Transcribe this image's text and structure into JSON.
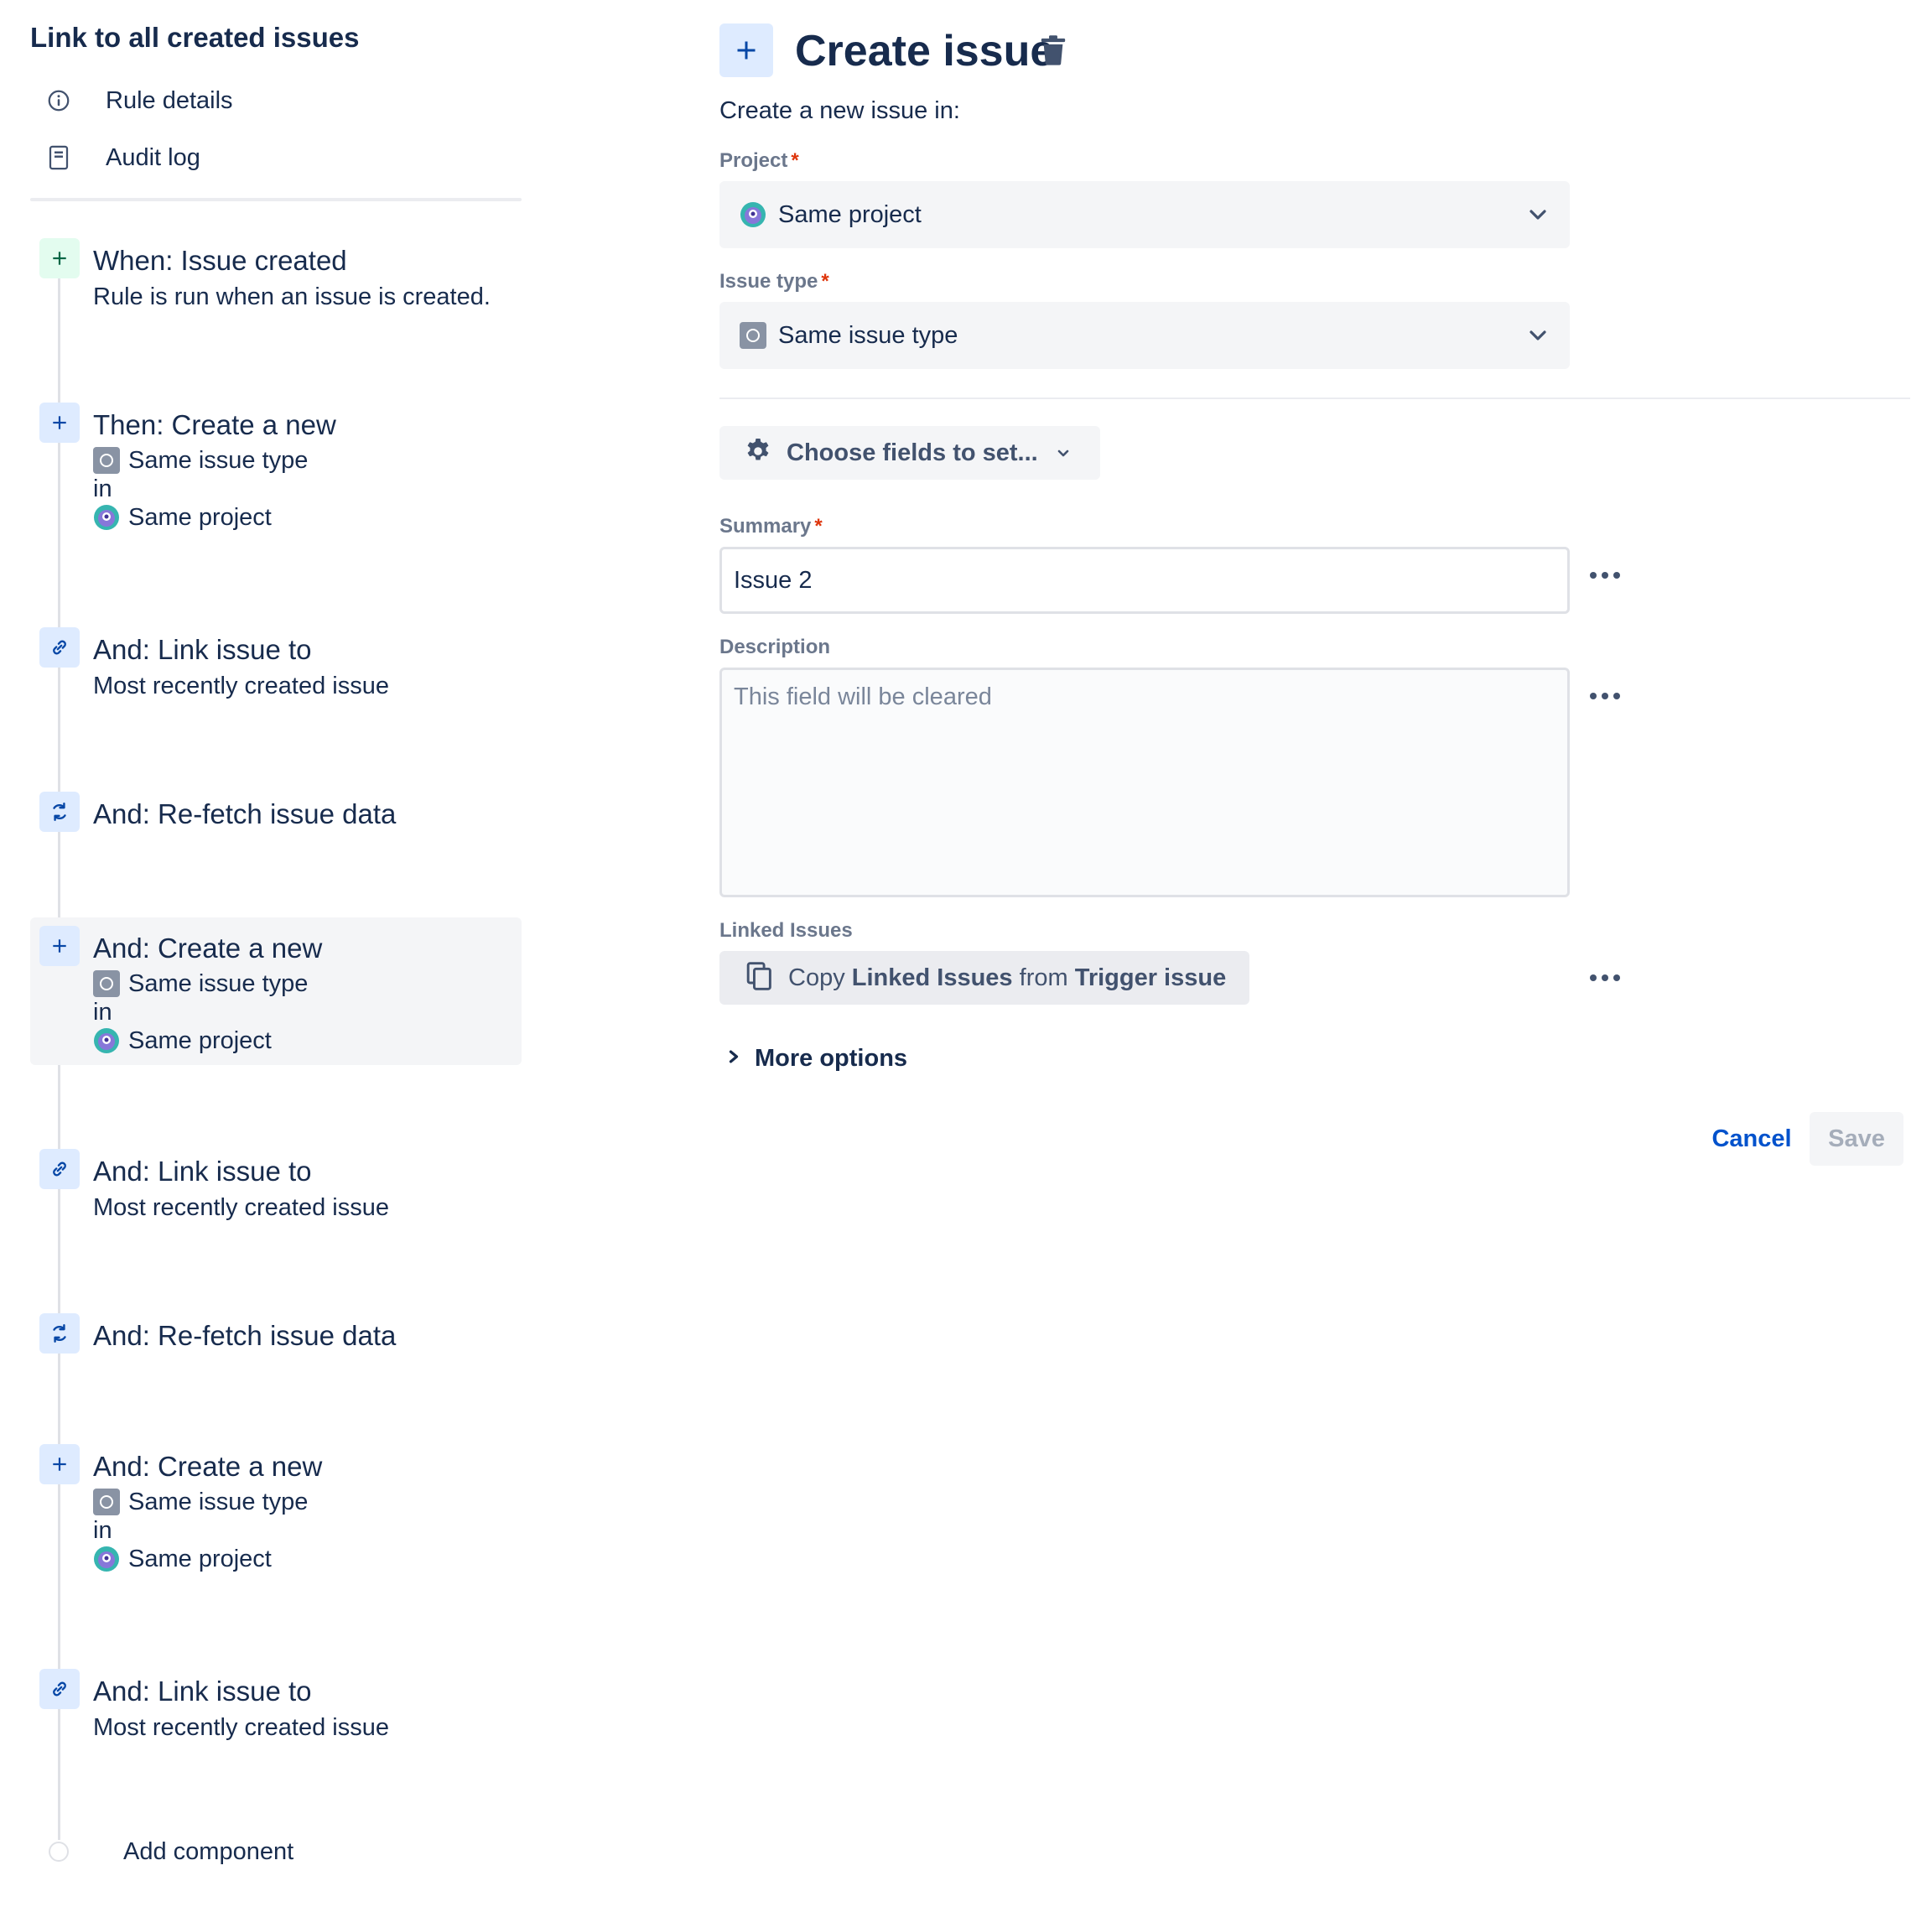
{
  "colors": {
    "text": "#172b4d",
    "subtle": "#6b778c",
    "link": "#0052cc",
    "required": "#de350b",
    "trigger_icon_bg": "#e3fcef",
    "action_icon_bg": "#deebff"
  },
  "rule": {
    "title": "Link to all created issues",
    "menu": [
      {
        "label": "Rule details",
        "icon": "info-icon"
      },
      {
        "label": "Audit log",
        "icon": "document-icon"
      }
    ]
  },
  "steps": [
    {
      "kind": "trigger",
      "icon": "plus-icon",
      "title": "When: Issue created",
      "subtitle": "Rule is run when an issue is created."
    },
    {
      "kind": "create",
      "icon": "plus-icon",
      "title": "Then: Create a new",
      "type_label": "Same issue type",
      "in_label": "in",
      "project_label": "Same project"
    },
    {
      "kind": "link",
      "icon": "link-icon",
      "title": "And: Link issue to",
      "subtitle": "Most recently created issue"
    },
    {
      "kind": "refetch",
      "icon": "refresh-icon",
      "title": "And: Re-fetch issue data"
    },
    {
      "kind": "create",
      "icon": "plus-icon",
      "title": "And: Create a new",
      "type_label": "Same issue type",
      "in_label": "in",
      "project_label": "Same project",
      "selected": true
    },
    {
      "kind": "link",
      "icon": "link-icon",
      "title": "And: Link issue to",
      "subtitle": "Most recently created issue"
    },
    {
      "kind": "refetch",
      "icon": "refresh-icon",
      "title": "And: Re-fetch issue data"
    },
    {
      "kind": "create",
      "icon": "plus-icon",
      "title": "And: Create a new",
      "type_label": "Same issue type",
      "in_label": "in",
      "project_label": "Same project"
    },
    {
      "kind": "link",
      "icon": "link-icon",
      "title": "And: Link issue to",
      "subtitle": "Most recently created issue"
    }
  ],
  "add_component": "Add component",
  "editor": {
    "title": "Create issue",
    "intro": "Create a new issue in:",
    "project": {
      "label": "Project",
      "required_mark": "*",
      "value": "Same project"
    },
    "issue_type": {
      "label": "Issue type",
      "required_mark": "*",
      "value": "Same issue type"
    },
    "choose_fields": "Choose fields to set...",
    "summary": {
      "label": "Summary",
      "required_mark": "*",
      "value": "Issue 2"
    },
    "description": {
      "label": "Description",
      "placeholder": "This field will be cleared"
    },
    "linked_issues": {
      "label": "Linked Issues",
      "copy": "Copy",
      "field": "Linked Issues",
      "from": "from",
      "source": "Trigger issue"
    },
    "more_options": "More options",
    "cancel": "Cancel",
    "save": "Save"
  }
}
